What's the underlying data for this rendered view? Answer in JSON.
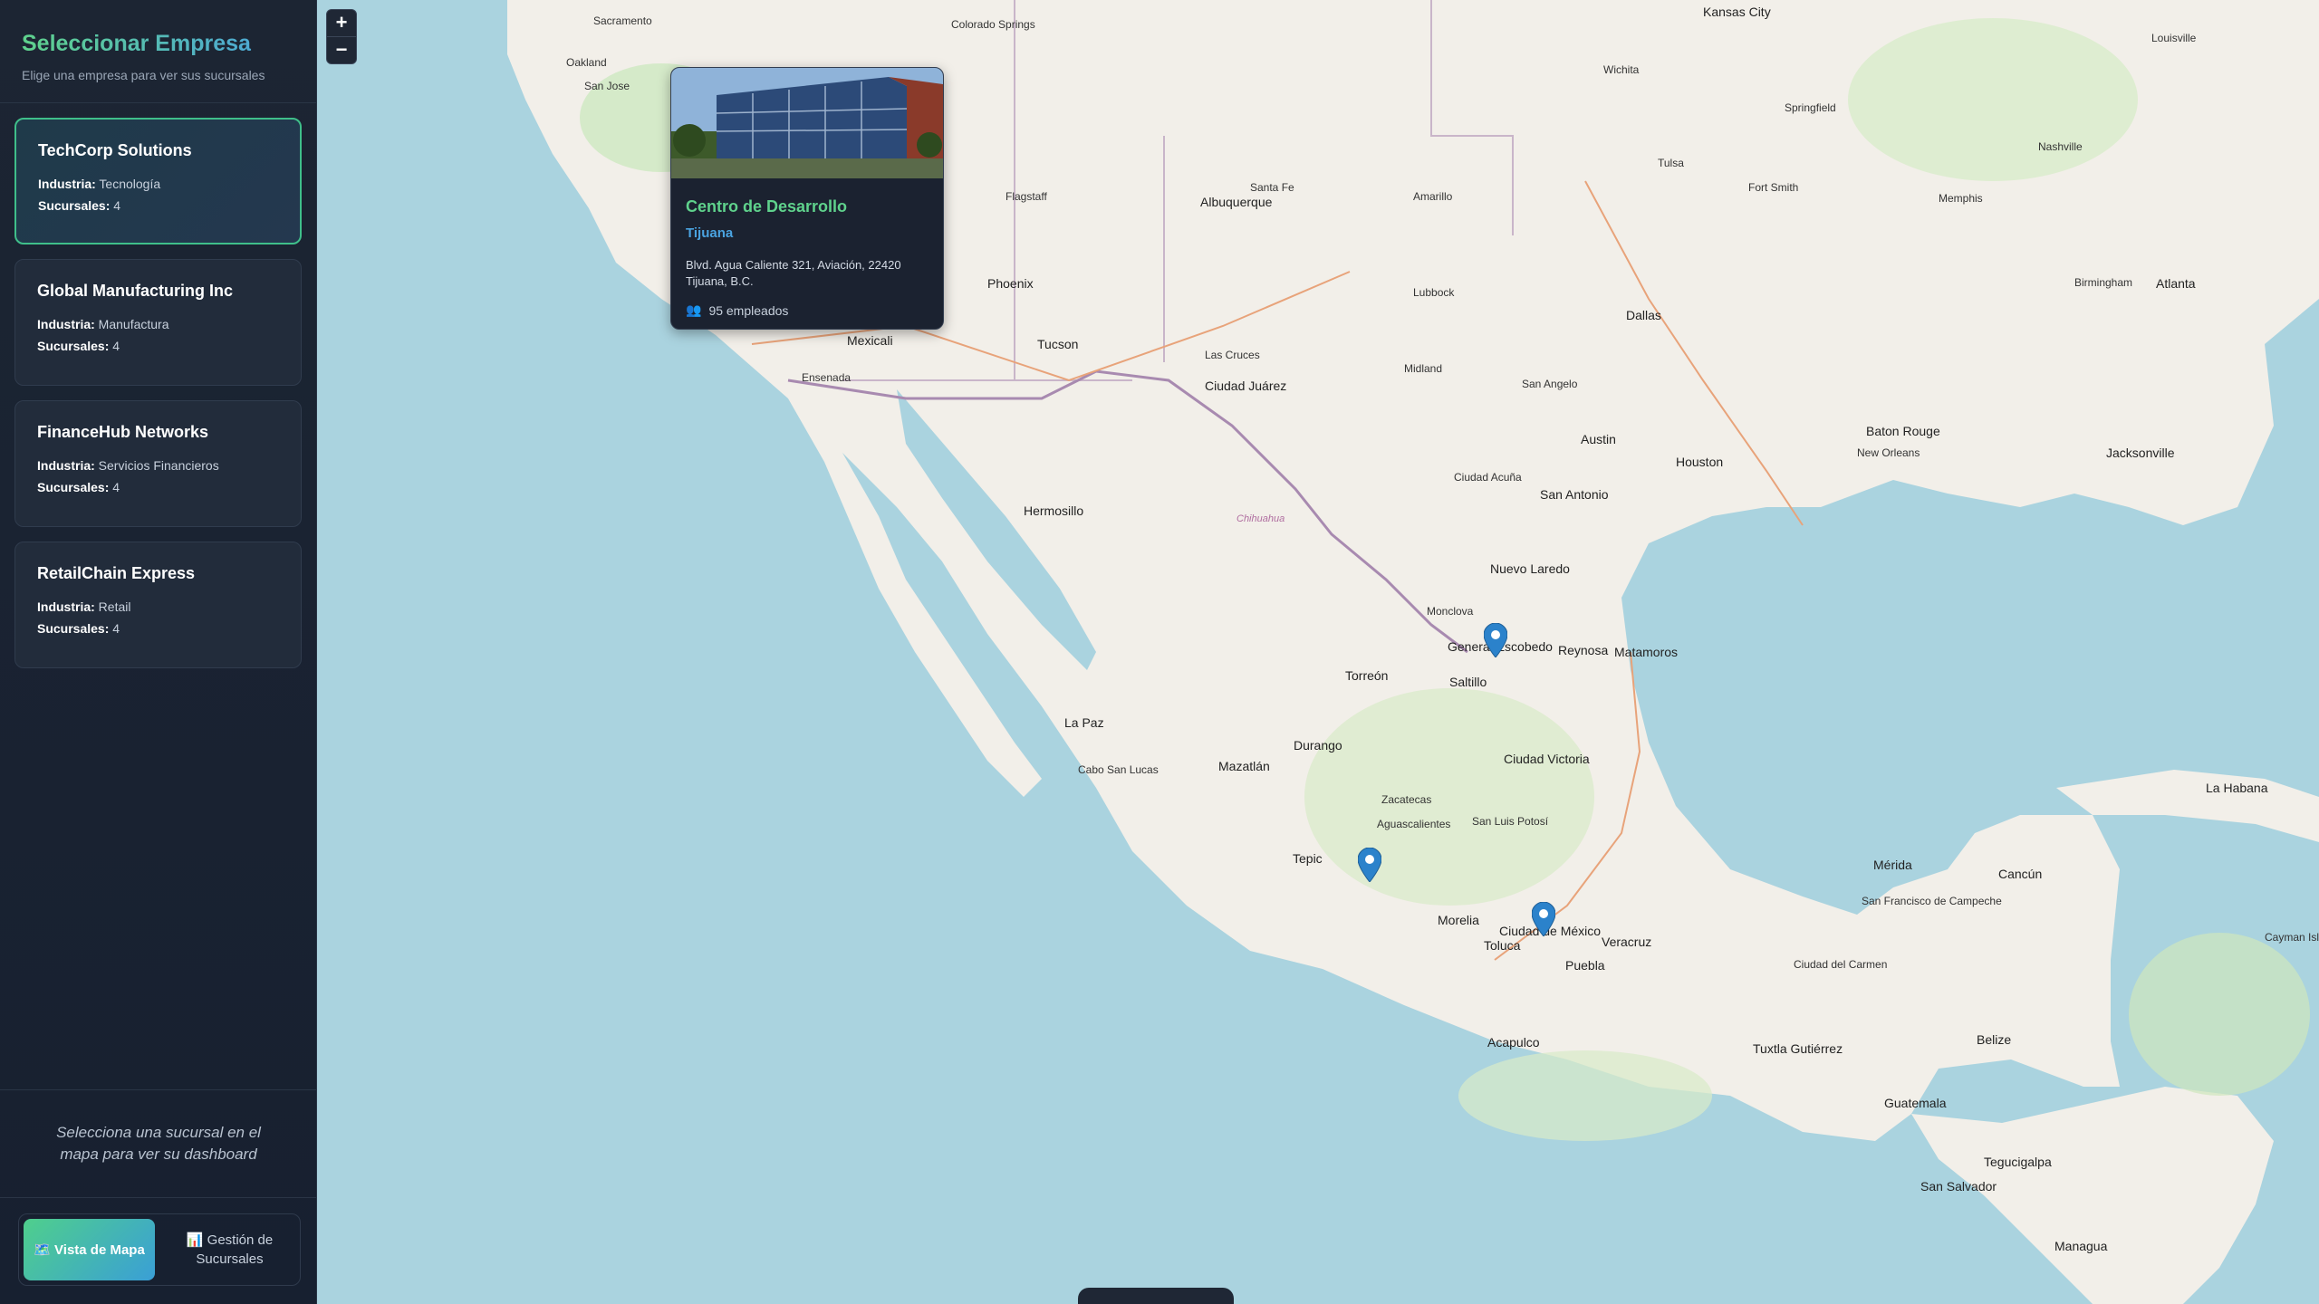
{
  "sidebar": {
    "title": "Seleccionar Empresa",
    "subtitle": "Elige una empresa para ver sus sucursales",
    "companies": [
      {
        "name": "TechCorp Solutions",
        "industry_label": "Industria:",
        "industry": "Tecnología",
        "branches_label": "Sucursales:",
        "branches": "4",
        "selected": true
      },
      {
        "name": "Global Manufacturing Inc",
        "industry_label": "Industria:",
        "industry": "Manufactura",
        "branches_label": "Sucursales:",
        "branches": "4",
        "selected": false
      },
      {
        "name": "FinanceHub Networks",
        "industry_label": "Industria:",
        "industry": "Servicios Financieros",
        "branches_label": "Sucursales:",
        "branches": "4",
        "selected": false
      },
      {
        "name": "RetailChain Express",
        "industry_label": "Industria:",
        "industry": "Retail",
        "branches_label": "Sucursales:",
        "branches": "4",
        "selected": false
      }
    ],
    "hint": "Selecciona una sucursal en el mapa para ver su dashboard",
    "tabs": [
      {
        "icon": "map-icon",
        "label": "Vista de Mapa",
        "active": true
      },
      {
        "icon": "chart-icon",
        "label": "Gestión de Sucursales",
        "active": false
      }
    ]
  },
  "map": {
    "zoom_in": "+",
    "zoom_out": "−",
    "popup": {
      "title": "Centro de Desarrollo",
      "city": "Tijuana",
      "address": "Blvd. Agua Caliente 321, Aviación, 22420 Tijuana, B.C.",
      "employees": "95 empleados"
    },
    "labels": {
      "sacramento": "Sacramento",
      "oakland": "Oakland",
      "san_jose": "San Jose",
      "colorado_springs": "Colorado Springs",
      "kansas_city": "Kansas City",
      "louisville": "Louisville",
      "wichita": "Wichita",
      "springfield": "Springfield",
      "nashville": "Nashville",
      "tulsa": "Tulsa",
      "memphis": "Memphis",
      "albuquerque": "Albuquerque",
      "santa_fe": "Santa Fe",
      "amarillo": "Amarillo",
      "flagstaff": "Flagstaff",
      "phoenix": "Phoenix",
      "fort_smith": "Fort Smith",
      "lubbock": "Lubbock",
      "dallas": "Dallas",
      "atlanta": "Atlanta",
      "birmingham": "Birmingham",
      "tucson": "Tucson",
      "mexicali": "Mexicali",
      "ensenada": "Ensenada",
      "las_cruces": "Las Cruces",
      "ciudad_juarez": "Ciudad Juárez",
      "el_paso": "Midland",
      "san_angelo": "San Angelo",
      "austin": "Austin",
      "houston": "Houston",
      "san_antonio": "San Antonio",
      "new_orleans": "New Orleans",
      "baton_rouge": "Baton Rouge",
      "jacksonville": "Jacksonville",
      "hermosillo": "Hermosillo",
      "chihuahua": "Chihuahua",
      "ciudad_acuna": "Ciudad Acuña",
      "nuevo_laredo": "Nuevo Laredo",
      "monterrey": "Monclova",
      "general_escobedo": "General Escobedo",
      "reynosa": "Reynosa",
      "matamoros": "Matamoros",
      "saltillo": "Saltillo",
      "torreon": "Torreón",
      "la_paz": "La Paz",
      "cabo_san_lucas": "Cabo San Lucas",
      "durango": "Durango",
      "mazatlan": "Mazatlán",
      "ciudad_victoria": "Ciudad Victoria",
      "tepic": "Tepic",
      "aguascalientes": "Aguascalientes",
      "san_luis_potosi": "San Luis Potosí",
      "zacatecas": "Zacatecas",
      "morelia": "Morelia",
      "ciudad_mexico": "Ciudad de México",
      "toluca": "Toluca",
      "puebla": "Puebla",
      "veracruz": "Veracruz",
      "acapulco": "Acapulco",
      "merida": "Mérida",
      "cancun": "Cancún",
      "tuxtla": "Tuxtla Gutiérrez",
      "guatemala": "Guatemala",
      "san_salvador": "San Salvador",
      "tegucigalpa": "Tegucigalpa",
      "managua": "Managua",
      "la_habana": "La Habana",
      "campeche": "San Francisco de Campeche",
      "villahermosa": "Ciudad del Carmen",
      "belize": "Belize",
      "cayman": "Cayman Islands"
    }
  }
}
